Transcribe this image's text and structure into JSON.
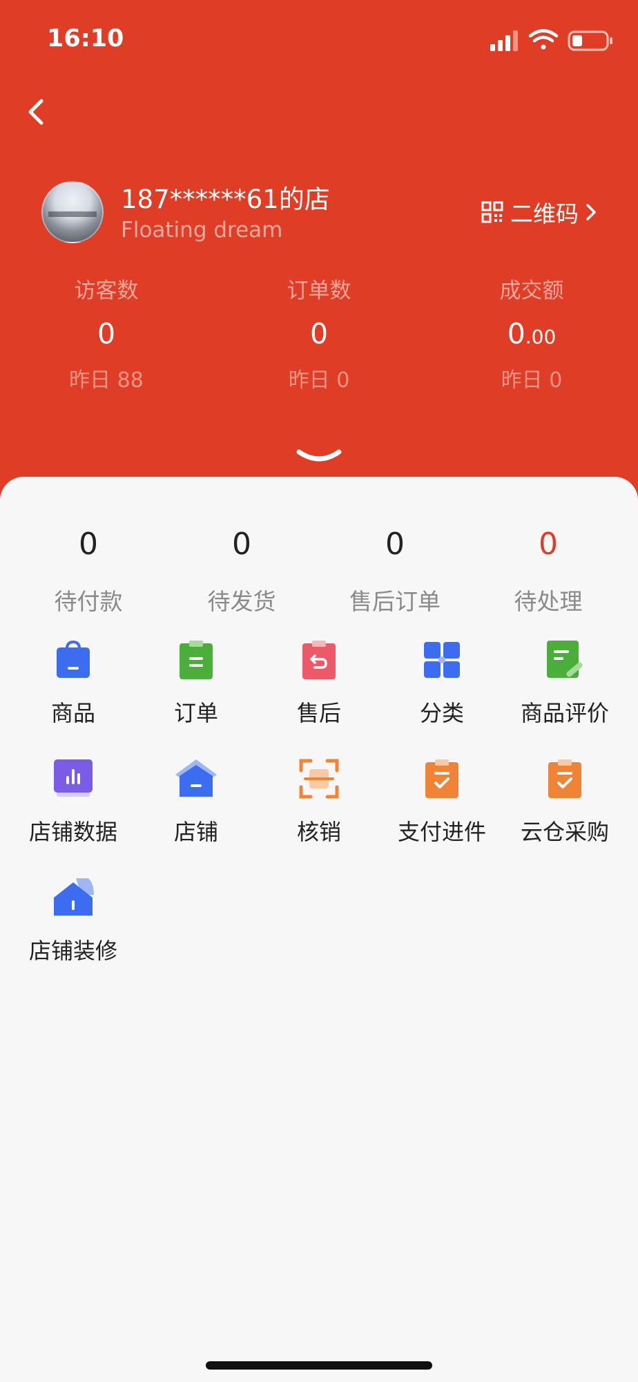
{
  "status_bar": {
    "time": "16:10"
  },
  "shop": {
    "name": "187******61的店",
    "subtitle": "Floating dream",
    "qr_label": "二维码"
  },
  "stats": [
    {
      "label": "访客数",
      "value": "0",
      "decimal": "",
      "yesterday": "昨日 88"
    },
    {
      "label": "订单数",
      "value": "0",
      "decimal": "",
      "yesterday": "昨日 0"
    },
    {
      "label": "成交额",
      "value": "0",
      "decimal": ".00",
      "yesterday": "昨日 0"
    }
  ],
  "order_counts": [
    {
      "value": "0",
      "label": "待付款"
    },
    {
      "value": "0",
      "label": "待发货"
    },
    {
      "value": "0",
      "label": "售后订单"
    },
    {
      "value": "0",
      "label": "待处理"
    }
  ],
  "menu": [
    {
      "label": "商品",
      "icon": "shopping-bag-icon"
    },
    {
      "label": "订单",
      "icon": "order-clipboard-icon"
    },
    {
      "label": "售后",
      "icon": "return-clipboard-icon"
    },
    {
      "label": "分类",
      "icon": "category-grid-icon"
    },
    {
      "label": "商品评价",
      "icon": "review-document-icon"
    },
    {
      "label": "店铺数据",
      "icon": "bar-chart-icon"
    },
    {
      "label": "店铺",
      "icon": "store-icon"
    },
    {
      "label": "核销",
      "icon": "scan-frame-icon"
    },
    {
      "label": "支付进件",
      "icon": "payment-clipboard-icon"
    },
    {
      "label": "云仓采购",
      "icon": "purchase-clipboard-icon"
    },
    {
      "label": "店铺装修",
      "icon": "shop-decoration-icon"
    }
  ],
  "colors": {
    "header_bg": "#e03d27",
    "alert_red": "#e03d27",
    "blue": "#3c6df0",
    "green": "#4bae3b",
    "pink": "#ec5a6a",
    "orange": "#ef8436",
    "purple": "#7a5ce6"
  }
}
